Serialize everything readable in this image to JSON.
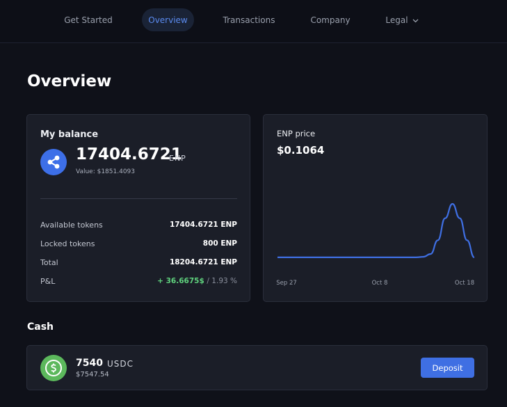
{
  "nav": {
    "items": [
      {
        "label": "Get Started",
        "active": false
      },
      {
        "label": "Overview",
        "active": true
      },
      {
        "label": "Transactions",
        "active": false
      },
      {
        "label": "Company",
        "active": false
      },
      {
        "label": "Legal",
        "active": false,
        "has_dropdown": true
      }
    ]
  },
  "page": {
    "title": "Overview"
  },
  "balance": {
    "heading": "My balance",
    "icon": "share-icon",
    "amount": "17404.6721",
    "unit": "ENP",
    "value_text": "Value: $1851.4093",
    "rows": [
      {
        "label": "Available tokens",
        "value": "17404.6721 ENP"
      },
      {
        "label": "Locked tokens",
        "value": "800 ENP"
      },
      {
        "label": "Total",
        "value": "18204.6721 ENP"
      }
    ],
    "pnl": {
      "label": "P&L",
      "value": "+ 36.6675$",
      "percent": "/ 1.93 %"
    }
  },
  "price": {
    "heading": "ENP price",
    "value": "$0.1064",
    "chart_data": {
      "type": "line",
      "x_labels": [
        "Sep 27",
        "Oct 8",
        "Oct 18"
      ],
      "series": [
        {
          "color": "#3f6fe3",
          "values": [
            0.009,
            0.009,
            0.009,
            0.009,
            0.009,
            0.009,
            0.009,
            0.009,
            0.009,
            0.009,
            0.009,
            0.009,
            0.009,
            0.009,
            0.009,
            0.009,
            0.009,
            0.009,
            0.009,
            0.009,
            0.01,
            0.015,
            0.04,
            0.08,
            0.106,
            0.08,
            0.04,
            0.009
          ]
        }
      ]
    }
  },
  "cash": {
    "section_title": "Cash",
    "icon": "usdc-icon",
    "amount": "7540",
    "unit": "USDC",
    "value": "$7547.54",
    "deposit_label": "Deposit"
  },
  "colors": {
    "background": "#0f1119",
    "card": "#1b1e28",
    "accent": "#3f6fe3",
    "positive": "#5fd17d",
    "usdc": "#5cb85c"
  }
}
